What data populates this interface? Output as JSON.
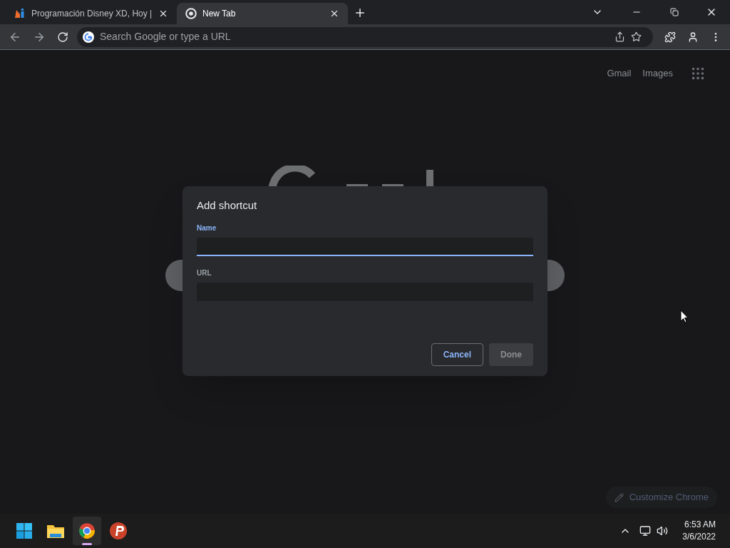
{
  "tabs": [
    {
      "title": "Programación Disney XD, Hoy |",
      "selected": false,
      "kind": "site"
    },
    {
      "title": "New Tab",
      "selected": true,
      "kind": "chrome"
    }
  ],
  "omnibox": {
    "placeholder": "Search Google or type a URL"
  },
  "top_links": [
    "Gmail",
    "Images"
  ],
  "dialog": {
    "title": "Add shortcut",
    "fields": [
      {
        "label": "Name",
        "focused": true
      },
      {
        "label": "URL",
        "focused": false
      }
    ],
    "buttons": [
      {
        "label": "Cancel",
        "disabled": false
      },
      {
        "label": "Done",
        "disabled": true
      }
    ]
  },
  "customize": "Customize Chrome",
  "taskbar": {
    "apps": [
      {
        "kind": "start",
        "selected": false
      },
      {
        "kind": "folder",
        "selected": false
      },
      {
        "kind": "chrome",
        "selected": true
      },
      {
        "kind": "psiphon",
        "selected": false
      }
    ],
    "time": "6:53 AM",
    "date": "3/6/2022"
  }
}
